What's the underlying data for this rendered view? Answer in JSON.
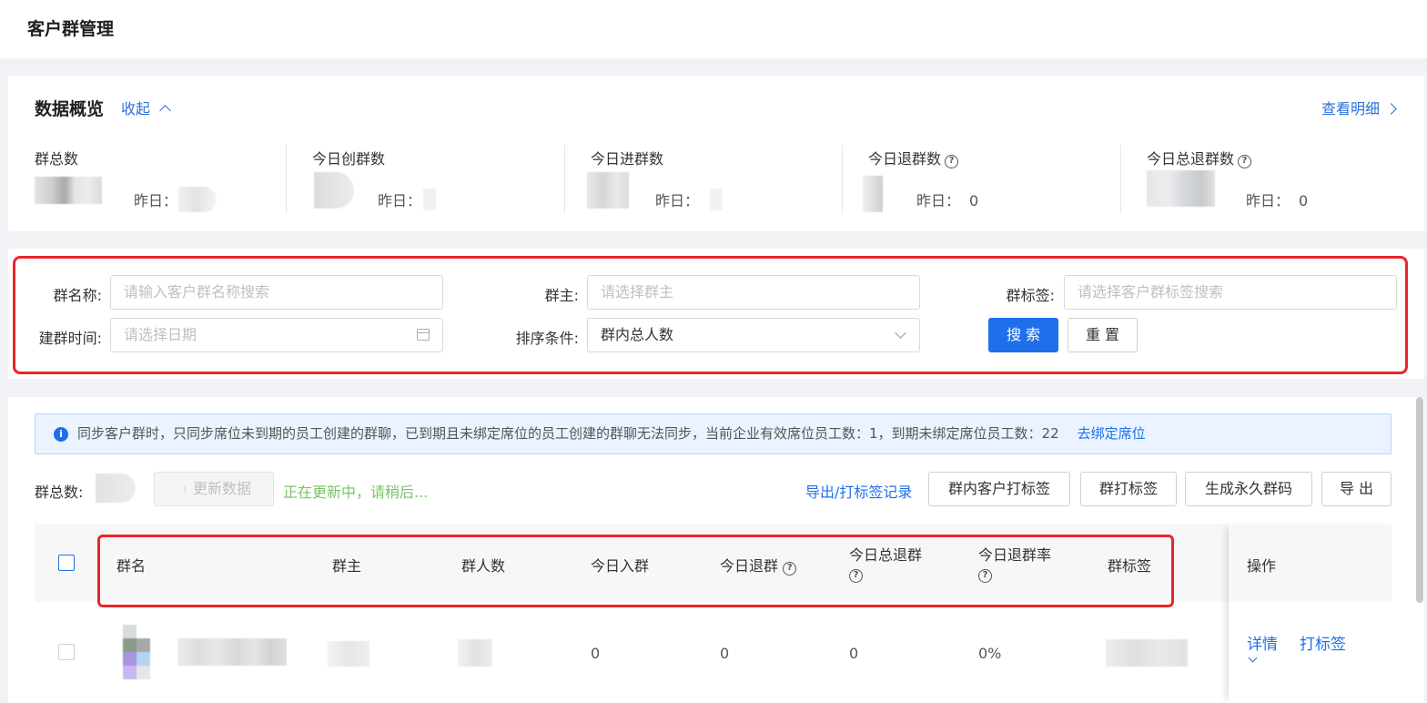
{
  "page": {
    "title": "客户群管理"
  },
  "overview": {
    "title": "数据概览",
    "collapse_label": "收起",
    "detail_label": "查看明细",
    "stats": [
      {
        "label": "群总数",
        "yesterday_label": "昨日：",
        "yesterday_value": ""
      },
      {
        "label": "今日创群数",
        "yesterday_label": "昨日：",
        "yesterday_value": ""
      },
      {
        "label": "今日进群数",
        "yesterday_label": "昨日：",
        "yesterday_value": ""
      },
      {
        "label": "今日退群数",
        "yesterday_label": "昨日：",
        "yesterday_value": "0"
      },
      {
        "label": "今日总退群数",
        "yesterday_label": "昨日：",
        "yesterday_value": "0"
      }
    ]
  },
  "filters": {
    "group_name_label": "群名称:",
    "group_name_placeholder": "请输入客户群名称搜索",
    "owner_label": "群主:",
    "owner_placeholder": "请选择群主",
    "tag_label": "群标签:",
    "tag_placeholder": "请选择客户群标签搜索",
    "created_label": "建群时间:",
    "created_placeholder": "请选择日期",
    "sort_label": "排序条件:",
    "sort_value": "群内总人数",
    "search_button": "搜 索",
    "reset_button": "重 置"
  },
  "notice": {
    "text": "同步客户群时，只同步席位未到期的员工创建的群聊，已到期且未绑定席位的员工创建的群聊无法同步，当前企业有效席位员工数：1，到期未绑定席位员工数：22",
    "link": "去绑定席位"
  },
  "toolbar": {
    "total_label": "群总数:",
    "refresh_button": "更新数据",
    "updating_text": "正在更新中，请稍后...",
    "export_log_link": "导出/打标签记录",
    "buttons": [
      "群内客户打标签",
      "群打标签",
      "生成永久群码",
      "导 出"
    ]
  },
  "table": {
    "columns": [
      "群名",
      "群主",
      "群人数",
      "今日入群",
      "今日退群",
      "今日总退群",
      "今日退群率",
      "群标签",
      "操作"
    ],
    "rows": [
      {
        "today_in": "0",
        "today_out": "0",
        "today_total_out": "0",
        "out_rate": "0%",
        "actions": [
          "详情",
          "打标签"
        ]
      }
    ]
  }
}
